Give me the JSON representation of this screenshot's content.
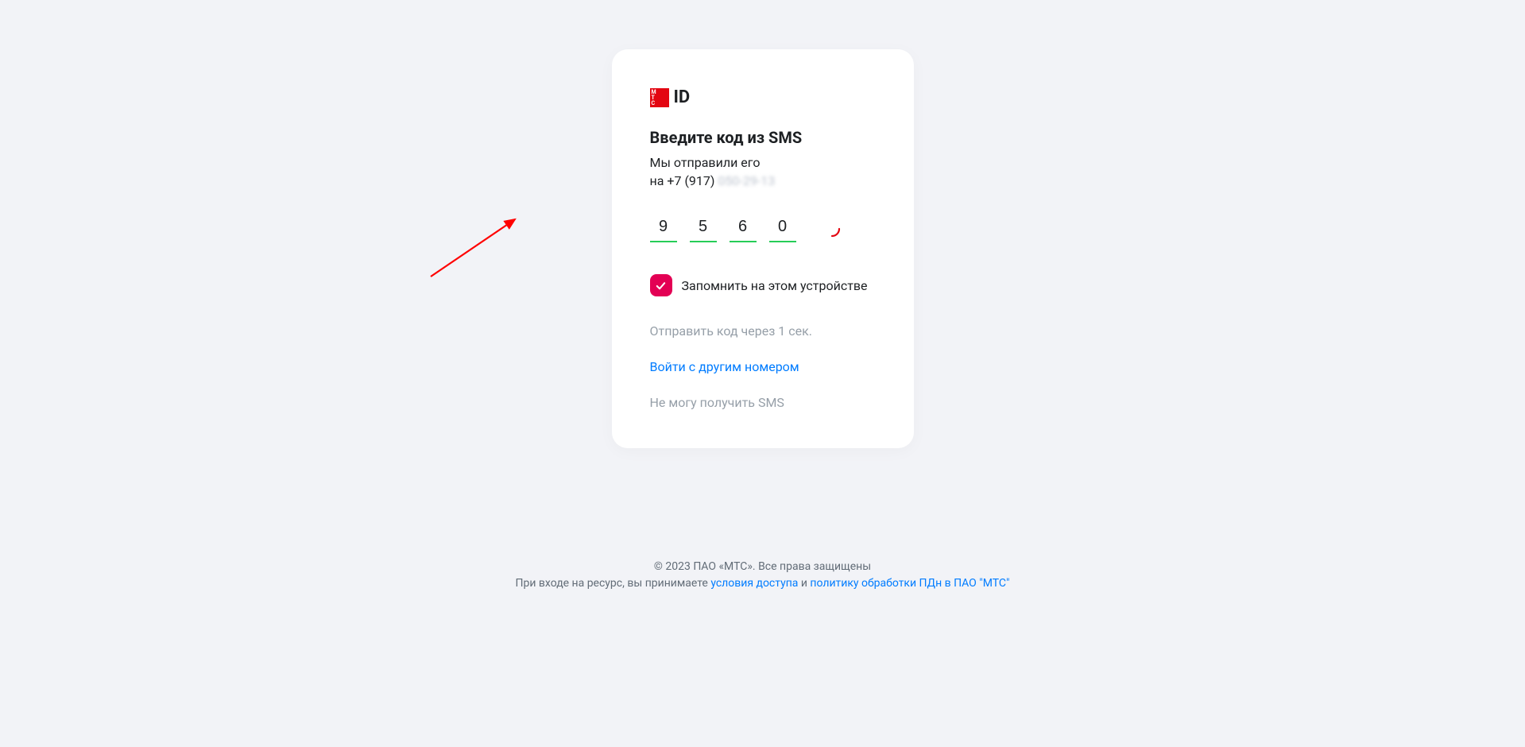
{
  "logo": {
    "id_text": "ID"
  },
  "card": {
    "title": "Введите код из SMS",
    "subtitle_line1": "Мы отправили его",
    "subtitle_prefix": "на +7 (917) ",
    "subtitle_masked": "050-29-13",
    "code_digits": [
      "9",
      "5",
      "6",
      "0"
    ],
    "remember_label": "Запомнить на этом устройстве",
    "remember_checked": true,
    "resend_text": "Отправить код через 1 сек.",
    "other_number_link": "Войти с другим номером",
    "cant_receive": "Не могу получить SMS"
  },
  "footer": {
    "copyright": "© 2023 ПАО «МТС». Все права защищены",
    "accept_prefix": "При входе на ресурс, вы принимаете ",
    "terms_link": "условия доступа",
    "and": " и ",
    "privacy_link": "политику обработки ПДн в ПАО \"МТС\""
  }
}
